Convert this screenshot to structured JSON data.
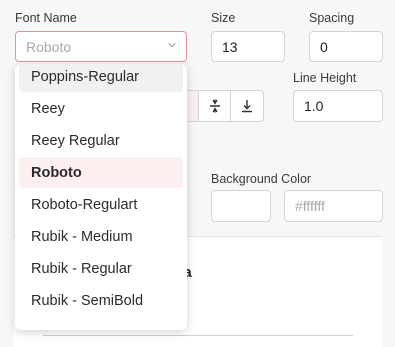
{
  "labels": {
    "font_name": "Font Name",
    "size": "Size",
    "spacing": "Spacing",
    "line_height": "Line Height",
    "background_color": "Background Color"
  },
  "font_select": {
    "value": "Roboto"
  },
  "size_input": {
    "value": "13"
  },
  "spacing_input": {
    "value": "0"
  },
  "line_height_input": {
    "value": "1.0"
  },
  "background_color_input": {
    "placeholder": "#ffffff"
  },
  "panel": {
    "title_fragment": "ata"
  },
  "font_options": [
    "Poppins-Regular",
    "Reey",
    "Reey Regular",
    "Roboto",
    "Roboto-Regulart",
    "Rubik - Medium",
    "Rubik - Regular",
    "Rubik - SemiBold"
  ],
  "selected_font": "Roboto",
  "colors": {
    "accent": "#e8909a",
    "selected_bg": "#fdeff0"
  },
  "icons": [
    "chevron-down-icon",
    "align-top-icon",
    "align-middle-icon",
    "align-bottom-icon"
  ]
}
